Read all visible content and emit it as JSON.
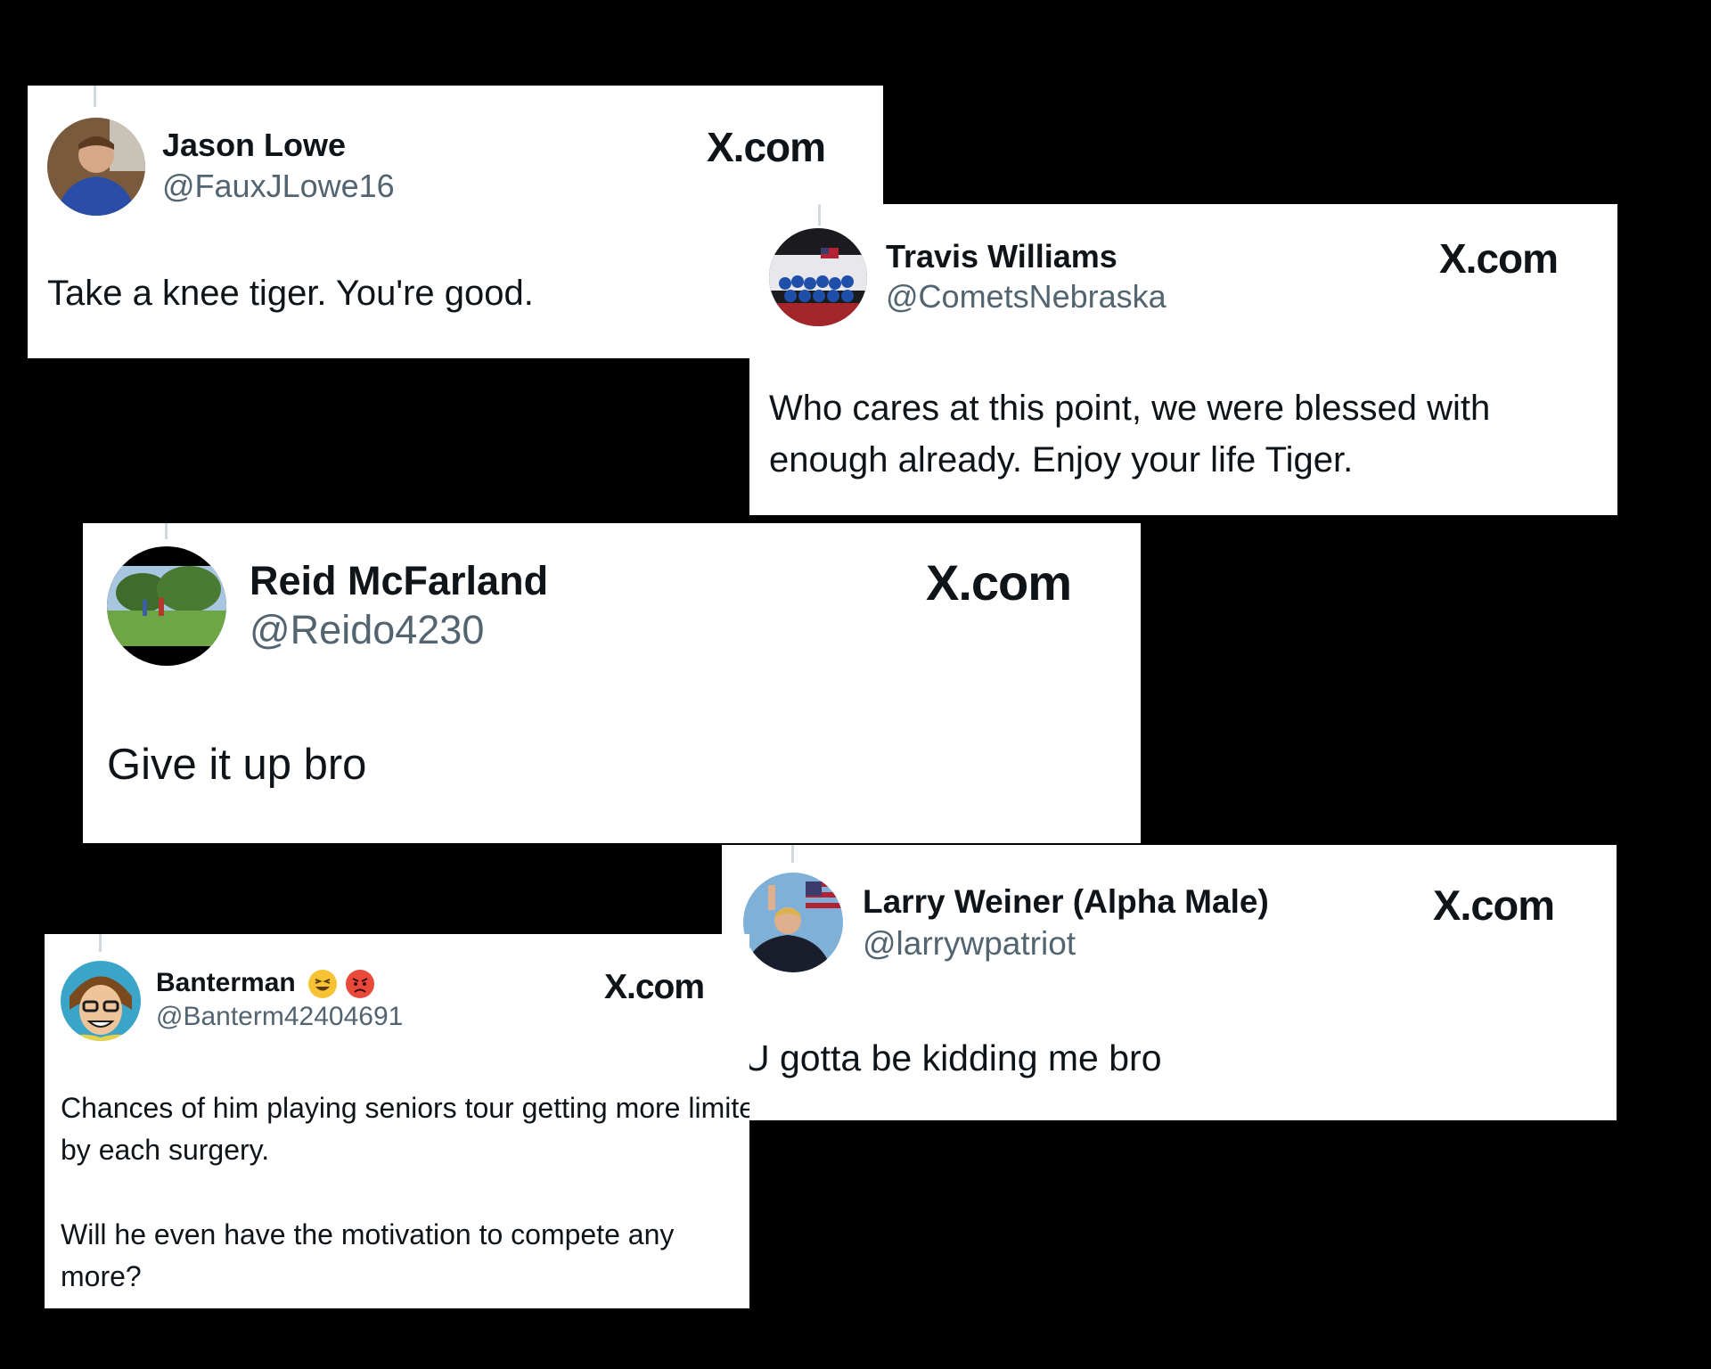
{
  "brand_label": "X.com",
  "posts": [
    {
      "display_name": "Jason Lowe",
      "handle": "@FauxJLowe16",
      "text": "Take a knee tiger. You're good."
    },
    {
      "display_name": "Travis Williams",
      "handle": "@CometsNebraska",
      "text": "Who cares at this point, we were blessed with enough already. Enjoy your life Tiger."
    },
    {
      "display_name": "Reid McFarland",
      "handle": "@Reido4230",
      "text": "Give it up bro"
    },
    {
      "display_name": "Larry Weiner (Alpha Male)",
      "handle": "@larrywpatriot",
      "text": "U gotta be kidding me bro"
    },
    {
      "display_name": "Banterman",
      "handle": "@Banterm42404691",
      "text_para1": "Chances of him playing seniors tour getting more limited by each surgery.",
      "text_para2": "Will he even have the motivation to compete any more?"
    }
  ],
  "colors": {
    "background": "#000000",
    "card": "#ffffff",
    "name": "#0f1419",
    "handle": "#536471"
  },
  "icons": {
    "brand": "x-logo-icon",
    "emoji_1": "grinning-squinting-face-icon",
    "emoji_2": "angry-face-icon"
  }
}
